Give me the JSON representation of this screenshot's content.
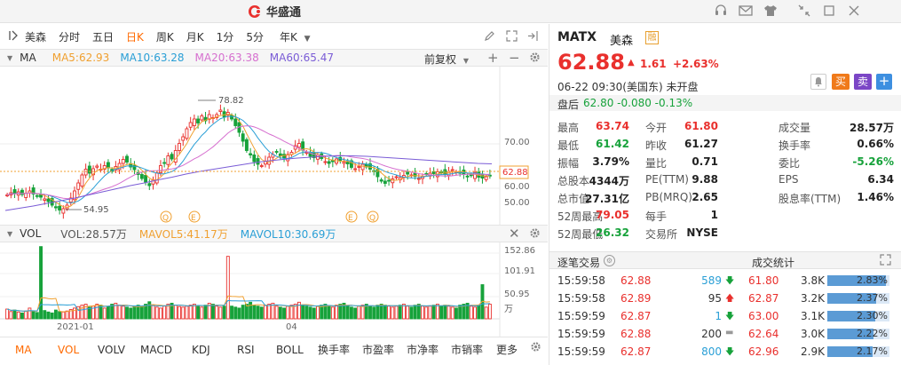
{
  "app": {
    "brand": "华盛通"
  },
  "toolbar": {
    "stock": "美森",
    "tabs": [
      "分时",
      "五日",
      "日K",
      "周K",
      "月K",
      "1分",
      "5分",
      "年K"
    ],
    "active": "日K"
  },
  "ma_line": {
    "title": "MA",
    "ma5": "MA5:62.93",
    "ma10": "MA10:63.28",
    "ma20": "MA20:63.38",
    "ma60": "MA60:65.47",
    "adjust": "前复权",
    "colors": {
      "ma5": "#f0a030",
      "ma10": "#2a9fd6",
      "ma20": "#d66fcf",
      "ma60": "#7a5cd6"
    }
  },
  "kchart": {
    "high_label": "78.82",
    "low_label": "54.95",
    "price_label": "62.88",
    "ticks": [
      "70.00",
      "60.00",
      "50.00"
    ],
    "markers": [
      "Q",
      "E",
      "E",
      "Q"
    ]
  },
  "vol_line": {
    "title": "VOL",
    "vol": "VOL:28.57万",
    "mavol5": "MAVOL5:41.17万",
    "mavol10": "MAVOL10:30.69万"
  },
  "vchart": {
    "ticks": [
      "152.86",
      "101.91",
      "50.95",
      "万"
    ],
    "x_labels": [
      "2021-01",
      "04"
    ]
  },
  "indicators": [
    "MA",
    "VOL",
    "VOLV",
    "MACD",
    "KDJ",
    "RSI",
    "BOLL",
    "换手率",
    "市盈率",
    "市净率",
    "市销率",
    "更多"
  ],
  "quote": {
    "symbol": "MATX",
    "name": "美森",
    "badge": "融",
    "price": "62.88",
    "change": "1.61",
    "change_pct": "+2.63%",
    "time": "06-22  09:30(美国东)  未开盘",
    "after_label": "盘后",
    "after_value": "62.80  -0.080  -0.13%",
    "buy": "买",
    "sell": "卖",
    "stats": [
      [
        "最高",
        "63.74",
        "今开",
        "61.80",
        "成交量",
        "28.57万"
      ],
      [
        "最低",
        "61.42",
        "昨收",
        "61.27",
        "换手率",
        "0.66%"
      ],
      [
        "振幅",
        "3.79%",
        "量比",
        "0.71",
        "委比",
        "-5.26%"
      ],
      [
        "总股本",
        "4344万",
        "PE(TTM)",
        "9.88",
        "EPS",
        "6.34"
      ],
      [
        "总市值",
        "27.31亿",
        "PB(MRQ)",
        "2.65",
        "股息率(TTM)",
        "1.46%"
      ],
      [
        "52周最高",
        "79.05",
        "每手",
        "1",
        "",
        ""
      ],
      [
        "52周最低",
        "26.32",
        "交易所",
        "NYSE",
        "",
        ""
      ]
    ],
    "trade_title": "逐笔交易",
    "stat_title": "成交统计",
    "trades": [
      [
        "15:59:58",
        "62.88",
        "589",
        "down"
      ],
      [
        "15:59:58",
        "62.89",
        "95",
        "up"
      ],
      [
        "15:59:59",
        "62.87",
        "1",
        "down"
      ],
      [
        "15:59:59",
        "62.88",
        "200",
        "flat"
      ],
      [
        "15:59:59",
        "62.87",
        "800",
        "down"
      ]
    ],
    "stats_rows": [
      [
        "61.80",
        "3.8K",
        "2.83%"
      ],
      [
        "62.87",
        "3.2K",
        "2.37%"
      ],
      [
        "63.00",
        "3.1K",
        "2.30%"
      ],
      [
        "62.64",
        "3.0K",
        "2.22%"
      ],
      [
        "62.96",
        "2.9K",
        "2.17%"
      ]
    ]
  },
  "chart_data": {
    "type": "candlestick",
    "description_series": "daily close (approx.)",
    "closes": [
      58.5,
      59.0,
      58.8,
      59.2,
      58.6,
      58.9,
      59.4,
      58.7,
      58.2,
      58.0,
      57.6,
      57.0,
      56.2,
      55.6,
      55.1,
      55.4,
      56.2,
      57.8,
      59.4,
      61.2,
      63.0,
      64.3,
      63.4,
      64.4,
      65.0,
      64.3,
      65.1,
      64.6,
      63.8,
      64.9,
      65.6,
      66.5,
      65.9,
      64.8,
      64.2,
      63.1,
      62.2,
      61.4,
      60.6,
      61.9,
      63.5,
      65.1,
      65.7,
      67.3,
      66.6,
      68.5,
      70.1,
      71.6,
      73.4,
      74.8,
      75.6,
      74.7,
      76.3,
      75.2,
      76.6,
      75.9,
      76.6,
      77.6,
      76.1,
      77.1,
      75.6,
      74.1,
      72.6,
      70.6,
      68.5,
      67.5,
      66.0,
      65.4,
      65.1,
      66.1,
      67.0,
      67.6,
      68.1,
      67.3,
      66.9,
      67.6,
      68.1,
      69.6,
      70.1,
      68.6,
      68.1,
      67.2,
      66.9,
      67.4,
      66.7,
      66.0,
      65.6,
      66.0,
      66.6,
      66.3,
      65.9,
      65.5,
      64.7,
      64.4,
      64.9,
      65.4,
      64.8,
      64.3,
      63.9,
      62.6,
      61.6,
      61.1,
      61.6,
      62.1,
      62.6,
      62.4,
      62.9,
      63.2,
      63.0,
      62.7,
      62.2,
      62.6,
      63.1,
      63.4,
      63.3,
      63.7,
      63.5,
      63.2,
      63.8,
      64.2,
      63.7,
      63.4,
      63.1,
      62.7,
      62.9,
      63.6,
      62.5,
      62.3,
      62.6,
      62.9
    ],
    "ma60": [
      55,
      55.5,
      56,
      56.6,
      57.2,
      57.8,
      58.5,
      59.2,
      59.9,
      60.6,
      61.2,
      61.9,
      62.5,
      63.2,
      63.8,
      64.3,
      64.8,
      65.3,
      65.8,
      66.2,
      66.5,
      66.8,
      67.0,
      67.2,
      67.3,
      67.3,
      67.2,
      67.0,
      66.8,
      66.6,
      66.4,
      66.2,
      66.0,
      65.8,
      65.6,
      65.5
    ],
    "volumes": [
      20,
      15,
      18,
      14,
      12,
      16,
      22,
      15,
      13,
      148,
      17,
      14,
      12,
      18,
      15,
      14,
      16,
      19,
      22,
      25,
      28,
      30,
      24,
      26,
      30,
      28,
      22,
      25,
      30,
      32,
      28,
      26,
      24,
      22,
      26,
      28,
      25,
      30,
      35,
      28,
      24,
      22,
      26,
      30,
      32,
      28,
      25,
      24,
      26,
      28,
      30,
      26,
      24,
      28,
      32,
      30,
      26,
      24,
      26,
      128,
      26,
      24,
      22,
      28,
      30,
      34,
      28,
      26,
      24,
      28,
      30,
      32,
      26,
      24,
      22,
      26,
      28,
      30,
      34,
      28,
      26,
      24,
      22,
      26,
      28,
      30,
      26,
      24,
      28,
      30,
      32,
      26,
      24,
      22,
      26,
      28,
      30,
      26,
      24,
      28,
      30,
      28,
      26,
      24,
      26,
      28,
      30,
      26,
      24,
      28,
      30,
      26,
      24,
      26,
      28,
      30,
      26,
      28,
      26,
      24,
      22,
      28,
      30,
      32,
      26,
      24,
      28,
      70,
      24,
      30
    ]
  }
}
